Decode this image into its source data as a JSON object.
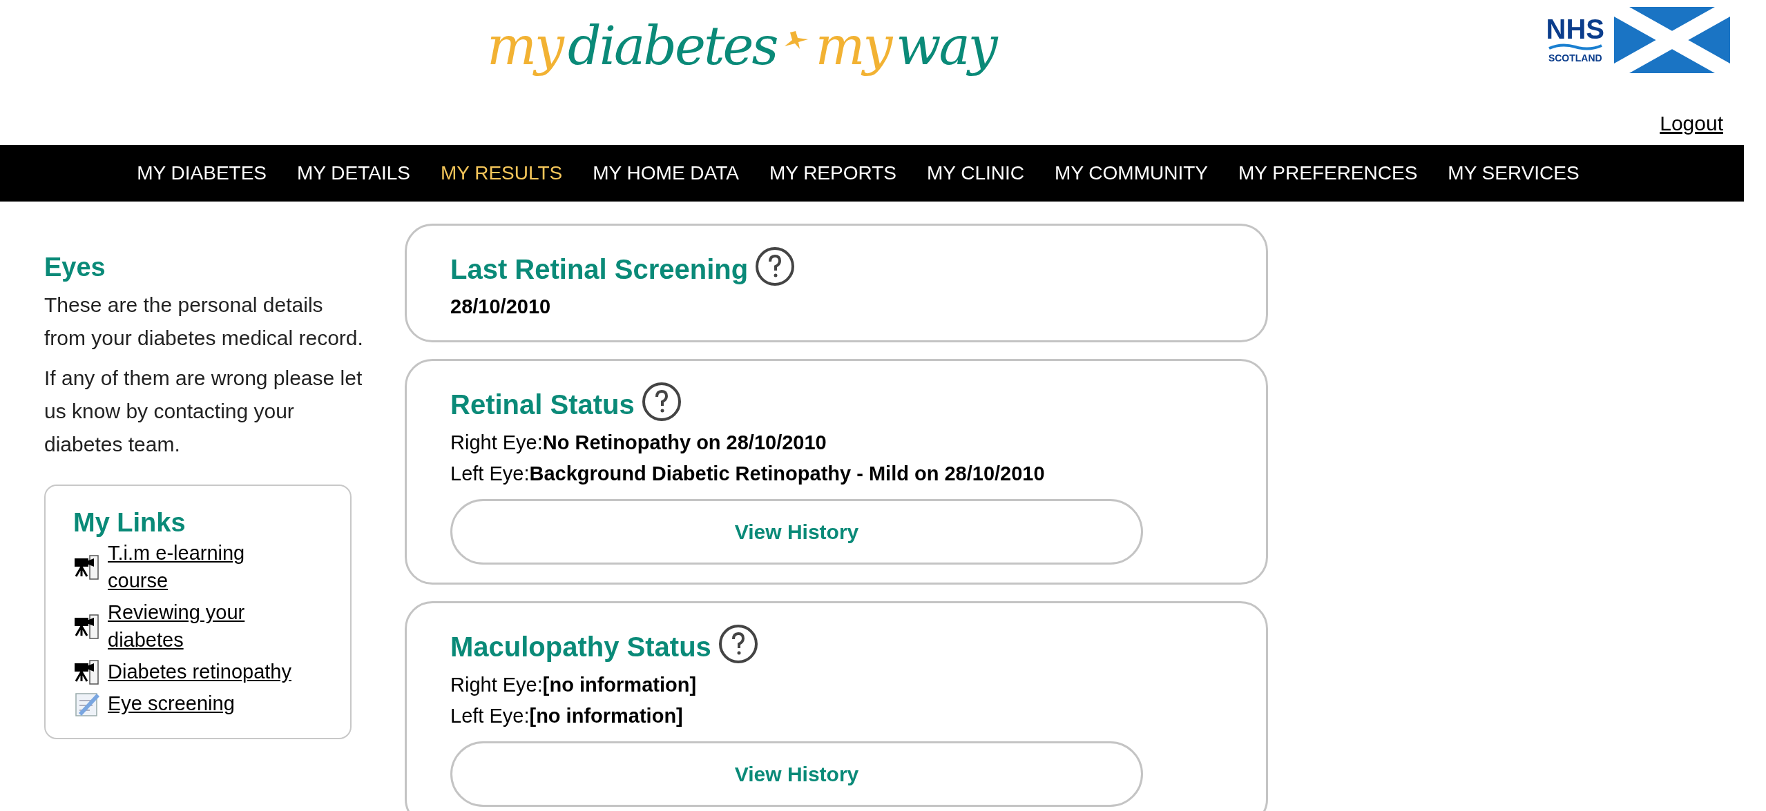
{
  "logo": {
    "words": [
      {
        "text": "my",
        "color": "#f2b233"
      },
      {
        "text": "diabetes",
        "color": "#0a8a78"
      },
      {
        "text": "my",
        "color": "#f2b233"
      },
      {
        "text": "way",
        "color": "#0a8a78"
      }
    ]
  },
  "nhs_logo": {
    "name": "NHS",
    "region": "SCOTLAND"
  },
  "logout": "Logout",
  "nav": [
    {
      "label": "MY DIABETES",
      "selected": false
    },
    {
      "label": "MY DETAILS",
      "selected": false
    },
    {
      "label": "MY RESULTS",
      "selected": true
    },
    {
      "label": "MY HOME DATA",
      "selected": false
    },
    {
      "label": "MY REPORTS",
      "selected": false
    },
    {
      "label": "MY CLINIC",
      "selected": false
    },
    {
      "label": "MY COMMUNITY",
      "selected": false
    },
    {
      "label": "MY PREFERENCES",
      "selected": false
    },
    {
      "label": "MY SERVICES",
      "selected": false
    }
  ],
  "sidebar": {
    "title": "Eyes",
    "paragraphs": [
      "These are the personal details from your diabetes medical record.",
      "If any of them are wrong please let us know by contacting your diabetes team."
    ],
    "links_box": {
      "title": "My Links",
      "links": [
        {
          "label": "T.i.m e-learning course",
          "kind": "video"
        },
        {
          "label": "Reviewing your diabetes",
          "kind": "video"
        },
        {
          "label": "Diabetes retinopathy",
          "kind": "video"
        },
        {
          "label": "Eye screening",
          "kind": "document"
        }
      ]
    }
  },
  "cards": [
    {
      "title": "Last Retinal Screening",
      "kind": "date",
      "value": "28/10/2010"
    },
    {
      "title": "Retinal Status",
      "kind": "status",
      "rows": [
        {
          "label": "Right Eye:",
          "value": "No Retinopathy on 28/10/2010"
        },
        {
          "label": "Left Eye:",
          "value": "Background Diabetic Retinopathy - Mild on 28/10/2010"
        }
      ],
      "button": "View History"
    },
    {
      "title": "Maculopathy Status",
      "kind": "status",
      "rows": [
        {
          "label": "Right Eye:",
          "value": "[no information]"
        },
        {
          "label": "Left Eye:",
          "value": "[no information]"
        }
      ],
      "button": "View History"
    }
  ]
}
